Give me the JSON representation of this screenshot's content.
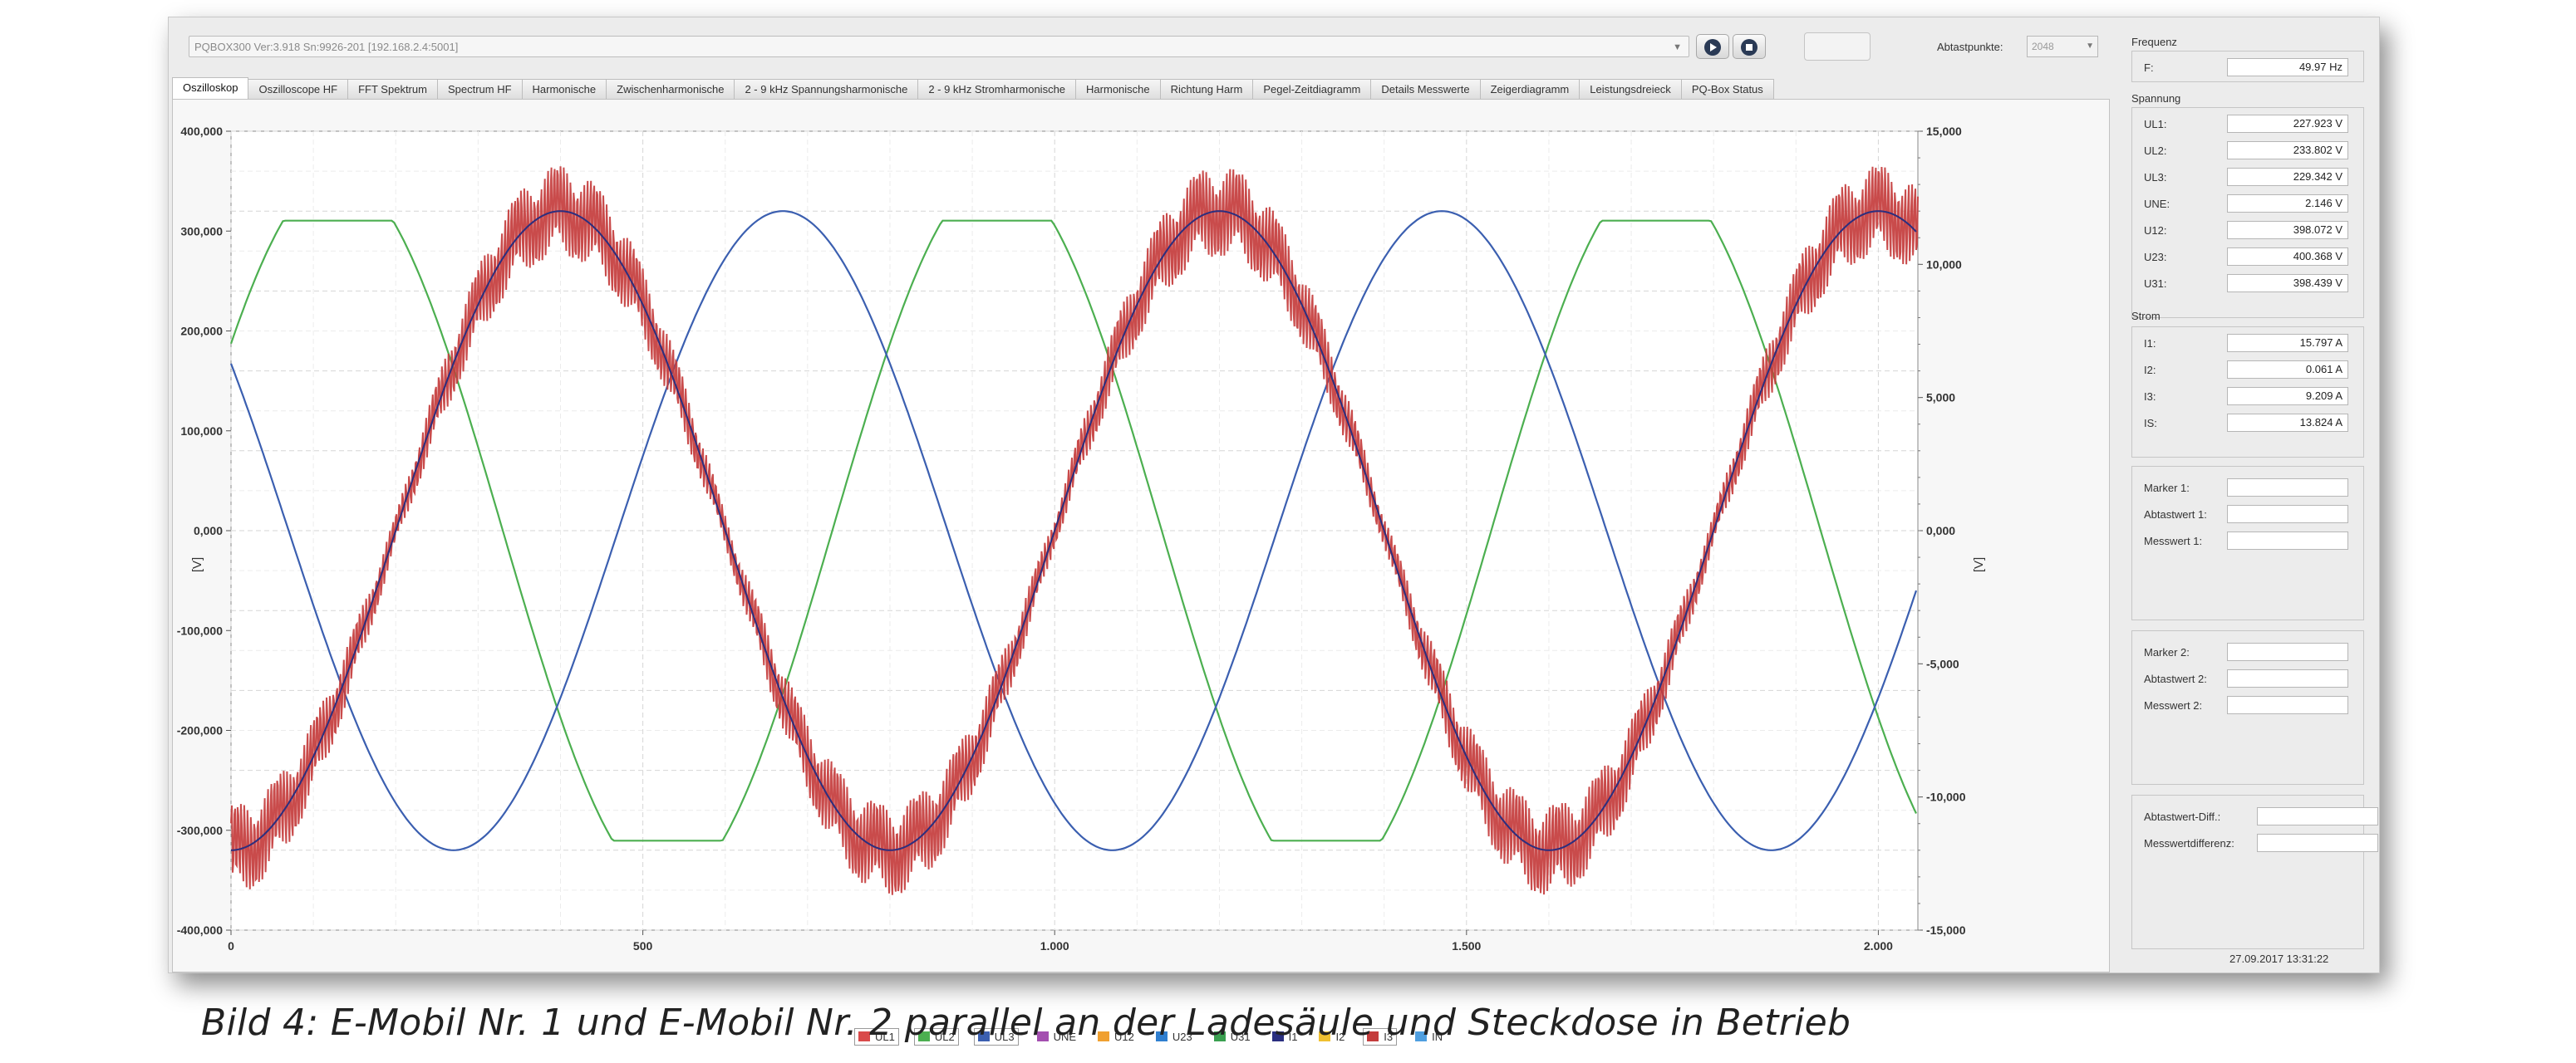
{
  "toolbar": {
    "device": "PQBOX300 Ver:3.918 Sn:9926-201 [192.168.2.4:5001]",
    "abtastpunkte_label": "Abtastpunkte:",
    "abtastpunkte_value": "2048"
  },
  "tabs": [
    {
      "label": "Oszilloskop",
      "active": true
    },
    {
      "label": "Oszilloscope HF"
    },
    {
      "label": "FFT Spektrum"
    },
    {
      "label": "Spectrum HF"
    },
    {
      "label": "Harmonische"
    },
    {
      "label": "Zwischenharmonische"
    },
    {
      "label": "2 - 9 kHz Spannungsharmonische"
    },
    {
      "label": "2 - 9 kHz Stromharmonische"
    },
    {
      "label": "Harmonische"
    },
    {
      "label": "Richtung Harm"
    },
    {
      "label": "Pegel-Zeitdiagramm"
    },
    {
      "label": "Details Messwerte"
    },
    {
      "label": "Zeigerdiagramm"
    },
    {
      "label": "Leistungsdreieck"
    },
    {
      "label": "PQ-Box Status"
    }
  ],
  "right_panel": {
    "frequenz_title": "Frequenz",
    "f_label": "F:",
    "f_value": "49.97 Hz",
    "spannung_title": "Spannung",
    "spannung": [
      {
        "label": "UL1:",
        "value": "227.923 V"
      },
      {
        "label": "UL2:",
        "value": "233.802 V"
      },
      {
        "label": "UL3:",
        "value": "229.342 V"
      },
      {
        "label": "UNE:",
        "value": "2.146 V"
      },
      {
        "label": "U12:",
        "value": "398.072 V"
      },
      {
        "label": "U23:",
        "value": "400.368 V"
      },
      {
        "label": "U31:",
        "value": "398.439 V"
      }
    ],
    "strom_title": "Strom",
    "strom": [
      {
        "label": "I1:",
        "value": "15.797 A"
      },
      {
        "label": "I2:",
        "value": "0.061 A"
      },
      {
        "label": "I3:",
        "value": "9.209 A"
      },
      {
        "label": "IS:",
        "value": "13.824 A"
      }
    ],
    "marker1": [
      "Marker 1:",
      "Abtastwert 1:",
      "Messwert 1:"
    ],
    "marker2": [
      "Marker 2:",
      "Abtastwert 2:",
      "Messwert 2:"
    ],
    "diff": [
      "Abtastwert-Diff.:",
      "Messwertdifferenz:"
    ],
    "timestamp": "27.09.2017 13:31:22"
  },
  "legend": [
    {
      "label": "UL1",
      "color": "#d94a4a",
      "boxed": true
    },
    {
      "label": "UL2",
      "color": "#4caf50",
      "boxed": true
    },
    {
      "label": "UL3",
      "color": "#3b5fb0",
      "boxed": true
    },
    {
      "label": "UNE",
      "color": "#a44fb0"
    },
    {
      "label": "U12",
      "color": "#f0a030"
    },
    {
      "label": "U23",
      "color": "#2f7fd0"
    },
    {
      "label": "U31",
      "color": "#3aa050"
    },
    {
      "label": "I1",
      "color": "#2a2f80"
    },
    {
      "label": "I2",
      "color": "#f0c030"
    },
    {
      "label": "I3",
      "color": "#c43c3c",
      "boxed": true
    },
    {
      "label": "IN",
      "color": "#4f9fe0"
    }
  ],
  "chart_data": {
    "type": "line",
    "xlabel": "",
    "ylabel": "[V]",
    "y2label": "[V]",
    "xlim": [
      0,
      2048
    ],
    "ylim": [
      -400000,
      400000
    ],
    "y2lim": [
      -15000,
      15000
    ],
    "x_ticks": [
      "0",
      "500",
      "1.000",
      "1.500",
      "2.000"
    ],
    "x_tick_values": [
      0,
      500,
      1000,
      1500,
      2000
    ],
    "y_ticks": [
      "400,000",
      "300,000",
      "200,000",
      "100,000",
      "0,000",
      "-100,000",
      "-200,000",
      "-300,000",
      "-400,000"
    ],
    "y_tick_values": [
      400000,
      300000,
      200000,
      100000,
      0,
      -100000,
      -200000,
      -300000,
      -400000
    ],
    "y2_ticks": [
      "15,000",
      "10,000",
      "5,000",
      "0,000",
      "-5,000",
      "-10,000",
      "-15,000"
    ],
    "y2_tick_values": [
      15000,
      10000,
      5000,
      0,
      -5000,
      -10000,
      -15000
    ],
    "grid": true,
    "legend": "bottom",
    "series": [
      {
        "name": "UL1",
        "color": "#d94a4a",
        "amplitude": 320000,
        "peak_x": [
          400,
          1200,
          2000
        ],
        "trough_x": [
          0,
          800,
          1600
        ]
      },
      {
        "name": "UL2",
        "color": "#4caf50",
        "amplitude": 320000,
        "peak_x": [
          130,
          930,
          1730
        ],
        "trough_x": [
          530,
          1330
        ]
      },
      {
        "name": "UL3",
        "color": "#3b5fb0",
        "amplitude": 320000,
        "peak_x": [
          670,
          1470
        ],
        "trough_x": [
          270,
          1070,
          1870
        ]
      },
      {
        "name": "I3",
        "color": "#c43c3c",
        "amplitude": 320000,
        "peak_x": [
          400,
          1200,
          2000
        ],
        "trough_x": [
          0,
          800,
          1600
        ],
        "ripple": 45000
      }
    ],
    "period_samples": 800
  }
}
